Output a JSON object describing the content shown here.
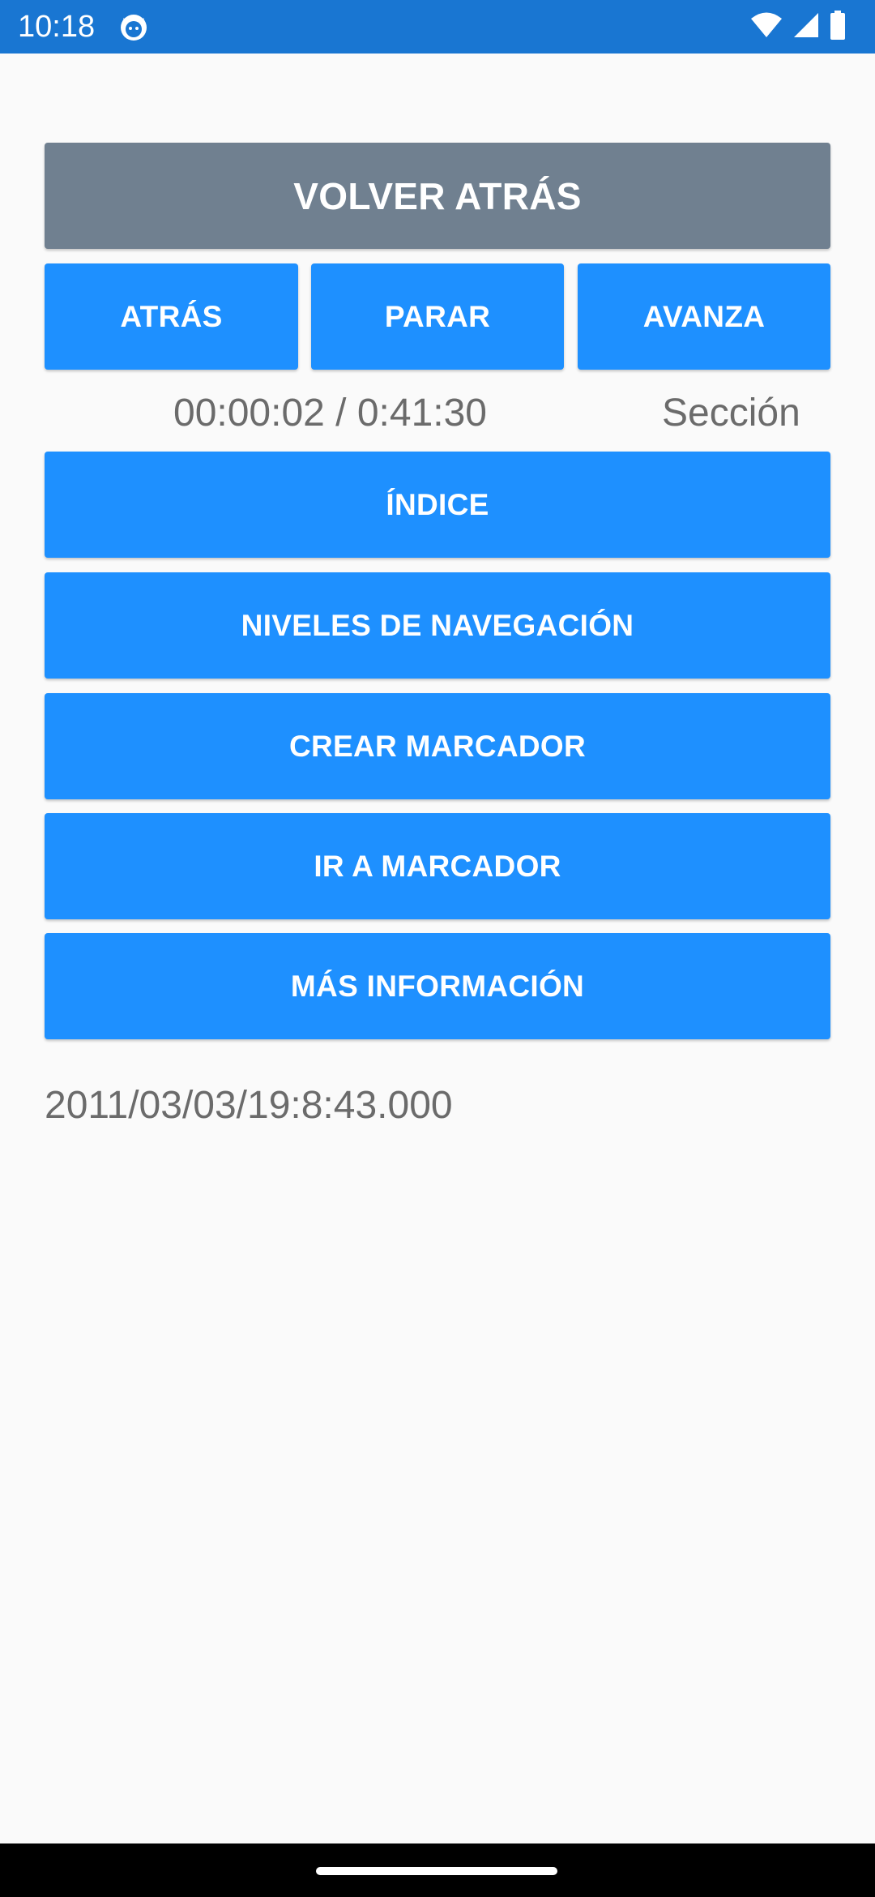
{
  "status_bar": {
    "time": "10:18",
    "background": "#1976d2",
    "app_icon": "cat-face-icon",
    "icons": [
      "wifi-icon",
      "cell-signal-icon",
      "battery-icon"
    ]
  },
  "colors": {
    "primary_button": "#1e90ff",
    "back_button": "#708090",
    "text_secondary": "#6b6b6b",
    "background": "#fafafa"
  },
  "buttons": {
    "back_main": "VOLVER ATRÁS",
    "prev": "ATRÁS",
    "stop": "PARAR",
    "next": "AVANZA",
    "index": "ÍNDICE",
    "nav_levels": "NIVELES DE NAVEGACIÓN",
    "create_bookmark": "CREAR MARCADOR",
    "goto_bookmark": "IR A MARCADOR",
    "more_info": "MÁS INFORMACIÓN"
  },
  "playback": {
    "time": "00:00:02 / 0:41:30",
    "level": "Sección"
  },
  "footer_text": "2011/03/03/19:8:43.000"
}
